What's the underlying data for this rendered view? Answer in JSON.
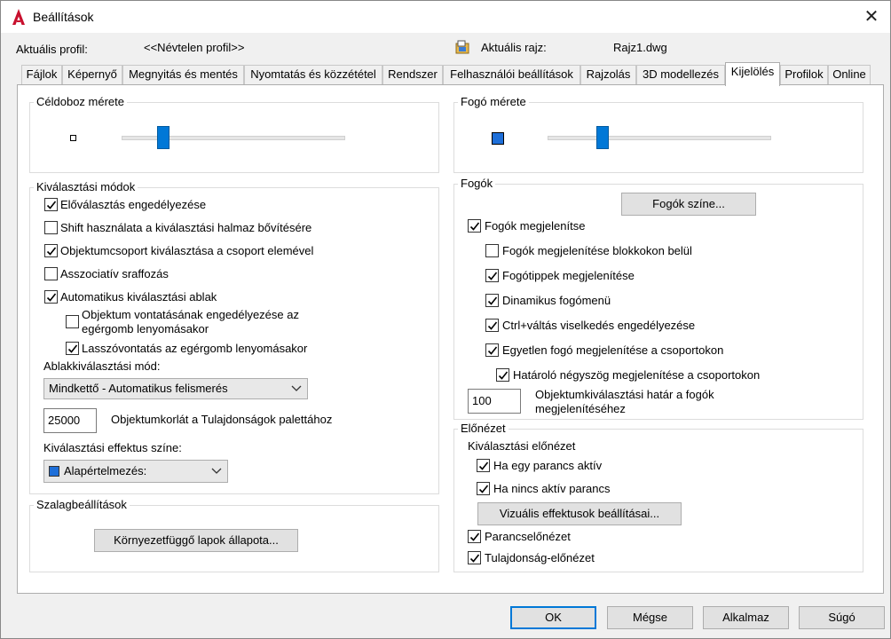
{
  "window": {
    "title": "Beállítások"
  },
  "header": {
    "profile_label": "Aktuális profil:",
    "profile_value": "<<Névtelen profil>>",
    "drawing_label": "Aktuális rajz:",
    "drawing_value": "Rajz1.dwg"
  },
  "tabs": [
    "Fájlok",
    "Képernyő",
    "Megnyitás és mentés",
    "Nyomtatás és közzététel",
    "Rendszer",
    "Felhasználói beállítások",
    "Rajzolás",
    "3D modellezés",
    "Kijelölés",
    "Profilok",
    "Online"
  ],
  "active_tab": "Kijelölés",
  "pickbox": {
    "title": "Céldoboz mérete",
    "slider_level": 0.17
  },
  "selection_modes": {
    "title": "Kiválasztási módok",
    "options": [
      {
        "label": "Előválasztás engedélyezése",
        "checked": true
      },
      {
        "label": "Shift használata a kiválasztási halmaz bővítésére",
        "checked": false
      },
      {
        "label": "Objektumcsoport kiválasztása a csoport elemével",
        "checked": true
      },
      {
        "label": "Asszociatív sraffozás",
        "checked": false
      },
      {
        "label": "Automatikus kiválasztási ablak",
        "checked": true
      }
    ],
    "sub_options": [
      {
        "label": "Objektum vontatásának engedélyezése az egérgomb lenyomásakor",
        "checked": false
      },
      {
        "label": "Lasszóvontatás az egérgomb lenyomásakor",
        "checked": true
      }
    ],
    "window_mode_label": "Ablakkiválasztási mód:",
    "window_mode_value": "Mindkettő - Automatikus felismerés",
    "object_limit_value": "25000",
    "object_limit_label": "Objektumkorlát a Tulajdonságok palettához",
    "effect_color_label": "Kiválasztási effektus színe:",
    "effect_color_value": "Alapértelmezés:",
    "effect_color_swatch": "#1e6fd9"
  },
  "ribbon": {
    "title": "Szalagbeállítások",
    "button": "Környezetfüggő lapok állapota..."
  },
  "grip_size": {
    "title": "Fogó mérete",
    "slider_level": 0.23
  },
  "grips": {
    "title": "Fogók",
    "color_button": "Fogók színe...",
    "show": {
      "label": "Fogók megjelenítse",
      "checked": true
    },
    "options": [
      {
        "label": "Fogók megjelenítése blokkokon belül",
        "checked": false
      },
      {
        "label": "Fogótippek megjelenítése",
        "checked": true
      },
      {
        "label": "Dinamikus fogómenü",
        "checked": true
      },
      {
        "label": "Ctrl+váltás viselkedés engedélyezése",
        "checked": true
      },
      {
        "label": "Egyetlen fogó megjelenítése a csoportokon",
        "checked": true
      }
    ],
    "bounding": {
      "label": "Határoló négyszög megjelenítése a csoportokon",
      "checked": true
    },
    "limit_value": "100",
    "limit_label_line1": "Objektumkiválasztási határ a fogók",
    "limit_label_line2": "megjelenítéséhez"
  },
  "preview": {
    "title": "Előnézet",
    "subtitle": "Kiválasztási előnézet",
    "active_cmd": {
      "label": "Ha egy parancs aktív",
      "checked": true
    },
    "no_cmd": {
      "label": "Ha nincs aktív parancs",
      "checked": true
    },
    "visual_button": "Vizuális effektusok beállításai...",
    "command_preview": {
      "label": "Parancselőnézet",
      "checked": true
    },
    "property_preview": {
      "label": "Tulajdonság-előnézet",
      "checked": true
    }
  },
  "footer": {
    "ok": "OK",
    "cancel": "Mégse",
    "apply": "Alkalmaz",
    "help": "Súgó"
  },
  "colors": {
    "accent": "#0078d7",
    "autocad_red": "#c8102e",
    "grip_blue": "#1e6fd9"
  }
}
